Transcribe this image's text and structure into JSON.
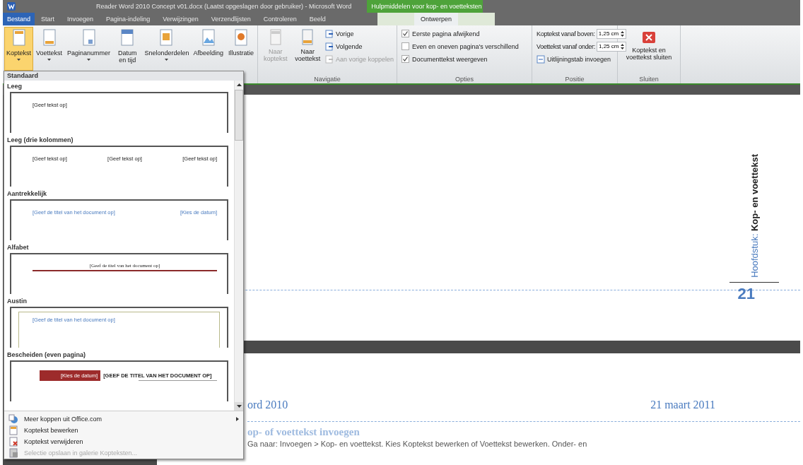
{
  "window": {
    "title": "Reader Word 2010 Concept v01.docx (Laatst opgeslagen door gebruiker)  -  Microsoft Word",
    "contextual_title": "Hulpmiddelen voor kop- en voetteksten"
  },
  "tabs": [
    {
      "label": "Bestand",
      "selected": false,
      "kind": "file"
    },
    {
      "label": "Start",
      "selected": false,
      "kind": "normal"
    },
    {
      "label": "Invoegen",
      "selected": false,
      "kind": "normal"
    },
    {
      "label": "Pagina-indeling",
      "selected": false,
      "kind": "normal"
    },
    {
      "label": "Verwijzingen",
      "selected": false,
      "kind": "normal"
    },
    {
      "label": "Verzendlijsten",
      "selected": false,
      "kind": "normal"
    },
    {
      "label": "Controleren",
      "selected": false,
      "kind": "normal"
    },
    {
      "label": "Beeld",
      "selected": false,
      "kind": "normal"
    },
    {
      "label": "Ontwerpen",
      "selected": true,
      "kind": "contextual"
    }
  ],
  "ribbon": {
    "insert_buttons": [
      {
        "label": "Koptekst",
        "dropdown": true,
        "active": true
      },
      {
        "label": "Voettekst",
        "dropdown": true,
        "active": false
      },
      {
        "label": "Paginanummer",
        "dropdown": true,
        "active": false
      },
      {
        "label": "Datum en tijd",
        "dropdown": false,
        "active": false
      },
      {
        "label": "Snelonderdelen",
        "dropdown": true,
        "active": false
      },
      {
        "label": "Afbeelding",
        "dropdown": false,
        "active": false
      },
      {
        "label": "Illustratie",
        "dropdown": false,
        "active": false
      }
    ],
    "navigation": {
      "label": "Navigatie",
      "big": [
        {
          "label": "Naar koptekst",
          "disabled": true
        },
        {
          "label": "Naar voettekst",
          "disabled": false
        }
      ],
      "small": [
        {
          "label": "Vorige",
          "disabled": false
        },
        {
          "label": "Volgende",
          "disabled": false
        },
        {
          "label": "Aan vorige koppelen",
          "disabled": true
        }
      ]
    },
    "options": {
      "label": "Opties",
      "items": [
        {
          "label": "Eerste pagina afwijkend",
          "checked": true
        },
        {
          "label": "Even en oneven pagina's verschillend",
          "checked": false
        },
        {
          "label": "Documenttekst weergeven",
          "checked": true
        }
      ]
    },
    "position": {
      "label": "Positie",
      "spinners": [
        {
          "label": "Koptekst vanaf boven:",
          "value": "1,25 cm"
        },
        {
          "label": "Voettekst vanaf onder:",
          "value": "1,25 cm"
        }
      ],
      "button": "Uitlijningstab invoegen"
    },
    "close": {
      "label": "Sluiten",
      "button": "Koptekst en voettekst sluiten"
    }
  },
  "gallery": {
    "category": "Standaard",
    "items": [
      {
        "name": "Leeg",
        "kind": "blank",
        "texts": [
          "[Geef tekst op]"
        ]
      },
      {
        "name": "Leeg (drie kolommen)",
        "kind": "three",
        "texts": [
          "[Geef tekst op]",
          "[Geef tekst op]",
          "[Geef tekst op]"
        ]
      },
      {
        "name": "Aantrekkelijk",
        "kind": "attractive",
        "texts": [
          "[Geef de titel van het document op]",
          "[Kies de datum]"
        ]
      },
      {
        "name": "Alfabet",
        "kind": "alphabet",
        "texts": [
          "[Geef de titel van het document op]"
        ]
      },
      {
        "name": "Austin",
        "kind": "austin",
        "texts": [
          "[Geef de titel van het document op]"
        ]
      },
      {
        "name": "Bescheiden (even pagina)",
        "kind": "modest",
        "texts": [
          "[Kies de datum]",
          "[GEEF DE TITEL VAN HET DOCUMENT OP]"
        ]
      }
    ],
    "menu": [
      {
        "label": "Meer koppen uit Office.com",
        "submenu": true,
        "disabled": false
      },
      {
        "label": "Koptekst bewerken",
        "submenu": false,
        "disabled": false
      },
      {
        "label": "Koptekst verwijderen",
        "submenu": false,
        "disabled": false
      },
      {
        "label": "Selectie opslaan in galerie Kopteksten...",
        "submenu": false,
        "disabled": true
      }
    ]
  },
  "document": {
    "page1": {
      "side_label": "Hoofdstuk:",
      "side_title": "Kop- en voettekst",
      "page_number": "21"
    },
    "page2": {
      "header_left": "ord 2010",
      "header_right": "21 maart 2011",
      "heading": "op- of voettekst invoegen",
      "body": "Ga naar: Invoegen > Kop- en voettekst. Kies Koptekst bewerken of Voettekst bewerken. Onder- en"
    }
  }
}
